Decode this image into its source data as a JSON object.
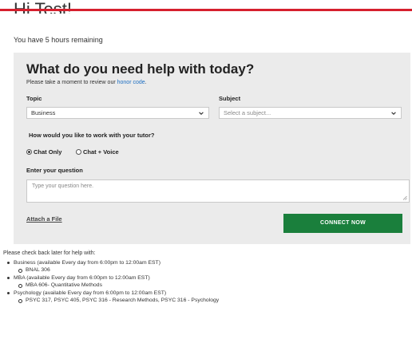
{
  "header": {
    "greeting": "Hi Test!",
    "remaining": "You have 5 hours remaining"
  },
  "form": {
    "title": "What do you need help with today?",
    "subtitle_prefix": "Please take a moment to review our ",
    "honor_code_link": "honor code",
    "subtitle_suffix": ".",
    "topic_label": "Topic",
    "topic_value": "Business",
    "subject_label": "Subject",
    "subject_placeholder": "Select a subject...",
    "work_label": "How would you like to work with your tutor?",
    "options": [
      {
        "label": "Chat Only",
        "selected": true
      },
      {
        "label": "Chat + Voice",
        "selected": false
      }
    ],
    "question_label": "Enter your question",
    "question_placeholder": "Type your question here.",
    "attach_label": "Attach a File",
    "connect_label": "CONNECT NOW"
  },
  "availability": {
    "intro": "Please check back later for help with:",
    "subjects": [
      {
        "name": "Business (available Every day from 6:00pm to 12:00am EST)",
        "courses": [
          "BNAL 306"
        ]
      },
      {
        "name": "MBA (available Every day from 6:00pm to 12:00am EST)",
        "courses": [
          "MBA 606- Quantitative Methods"
        ]
      },
      {
        "name": "Psychology (available Every day from 6:00pm to 12:00am EST)",
        "courses": [
          "PSYC 317, PSYC 405, PSYC 316 - Research Methods, PSYC 316 - Psychology"
        ]
      }
    ]
  },
  "colors": {
    "accent_red": "#d6202e",
    "connect_green": "#1a7f3c",
    "link_blue": "#1d6fc2",
    "panel_gray": "#ebebeb"
  },
  "icons": {
    "dropdown": "chevron-down-icon",
    "radio": "radio-icon",
    "resize": "resize-handle-icon"
  }
}
